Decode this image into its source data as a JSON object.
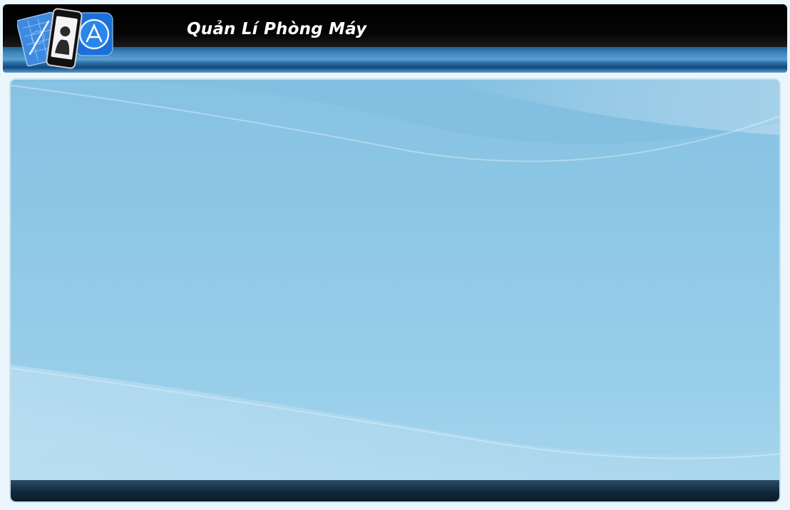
{
  "window": {
    "title": "Quản Lí Phòng Máy"
  },
  "icons": {
    "logo": "app-logo-icon",
    "blueprint": "blueprint-icon",
    "phone": "phone-contact-icon",
    "app_store": "app-store-icon"
  },
  "colors": {
    "titlebar": "#000000",
    "accent_strip": "#2b6ea5",
    "panel_background": "#8fc8e6",
    "status_bar": "#10273a",
    "title_text": "#ffffff"
  }
}
